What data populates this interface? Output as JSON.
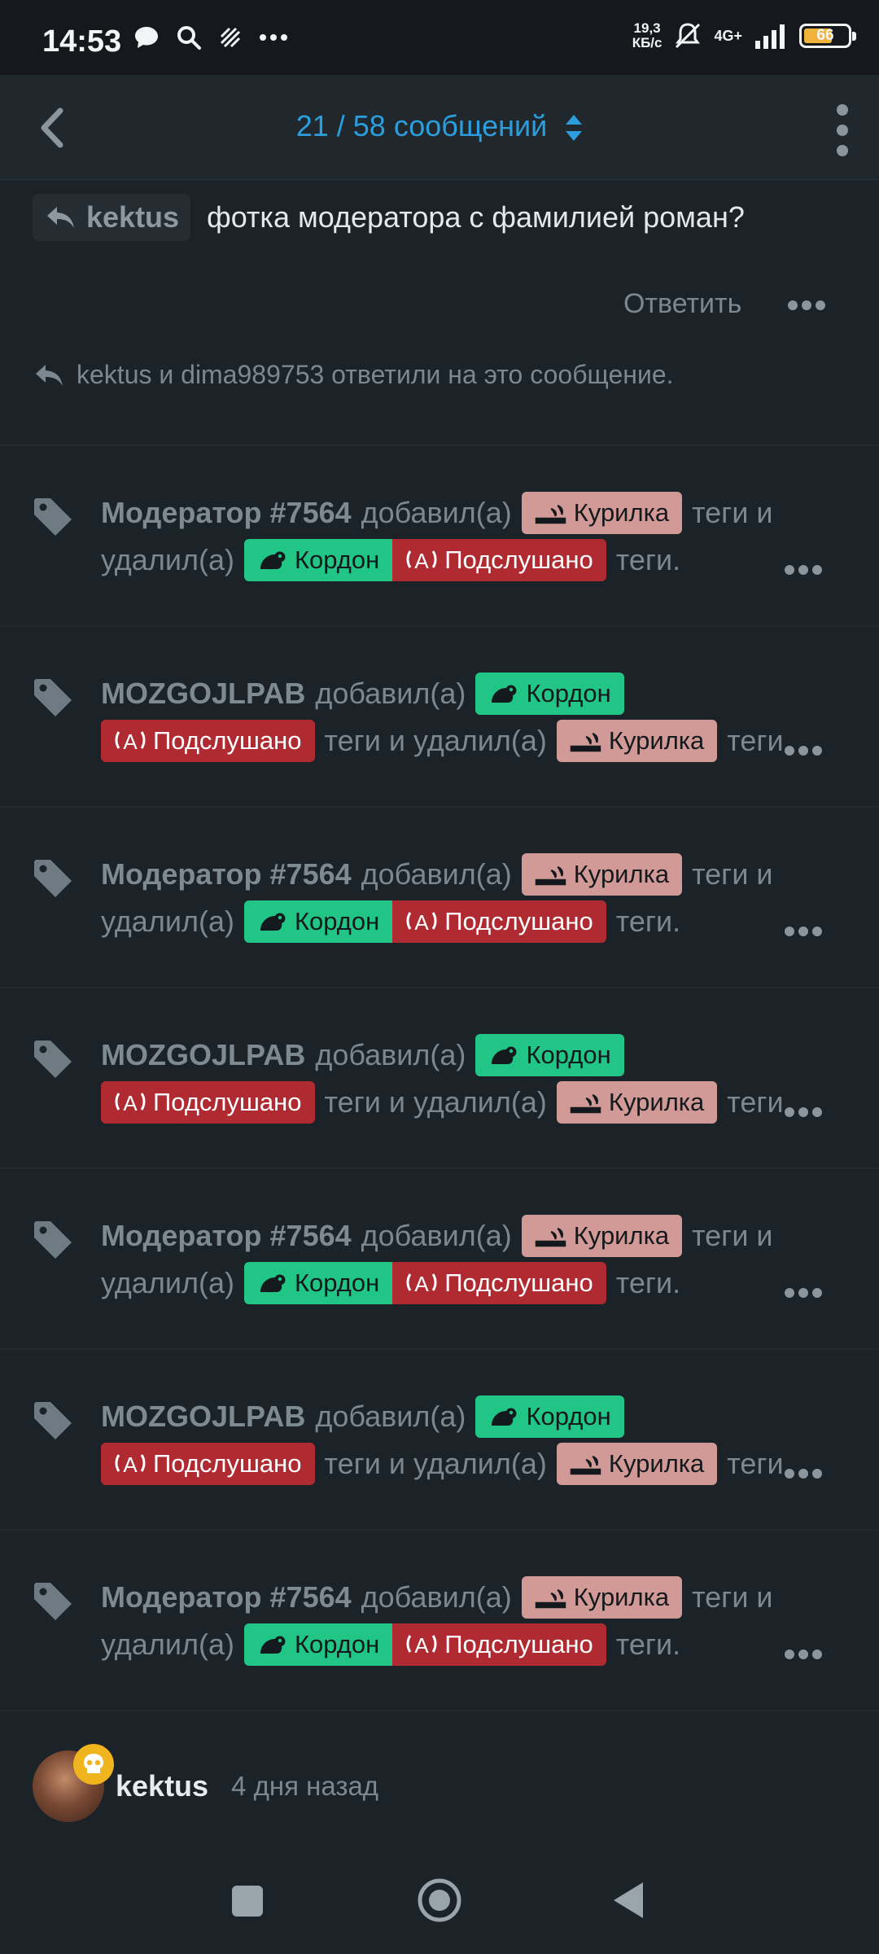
{
  "status": {
    "time": "14:53",
    "speed_value": "19,3",
    "speed_unit": "КБ/с",
    "network": "4G+",
    "battery": "66"
  },
  "header": {
    "title": "21 / 58 сообщений"
  },
  "message": {
    "quote_user": "kektus",
    "text": "фотка модератора с фамилией роман?",
    "reply_label": "Ответить",
    "replied_text": "kektus и dima989753 ответили на это сообщение."
  },
  "tags": {
    "kurilka": "Курилка",
    "kordon": "Кордон",
    "podslushano": "Подслушано"
  },
  "events": [
    {
      "user": "Модератор #7564",
      "added": "добавил(а)",
      "mid": "теги и",
      "removed": "удалил(а)",
      "end": "теги."
    },
    {
      "user": "MOZGOJLPAB",
      "added": "добавил(а)",
      "mid": "теги и удалил(а)",
      "end": "теги."
    },
    {
      "user": "Модератор #7564",
      "added": "добавил(а)",
      "mid": "теги и",
      "removed": "удалил(а)",
      "end": "теги."
    },
    {
      "user": "MOZGOJLPAB",
      "added": "добавил(а)",
      "mid": "теги и удалил(а)",
      "end": "теги."
    },
    {
      "user": "Модератор #7564",
      "added": "добавил(а)",
      "mid": "теги и",
      "removed": "удалил(а)",
      "end": "теги."
    },
    {
      "user": "MOZGOJLPAB",
      "added": "добавил(а)",
      "mid": "теги и удалил(а)",
      "end": "теги."
    },
    {
      "user": "Модератор #7564",
      "added": "добавил(а)",
      "mid": "теги и",
      "removed": "удалил(а)",
      "end": "теги."
    }
  ],
  "author": {
    "name": "kektus",
    "time": "4 дня назад"
  },
  "colors": {
    "accent": "#2c9ede",
    "kurilka": "#d29a97",
    "kordon": "#21c585",
    "podslushano": "#b02a31"
  }
}
